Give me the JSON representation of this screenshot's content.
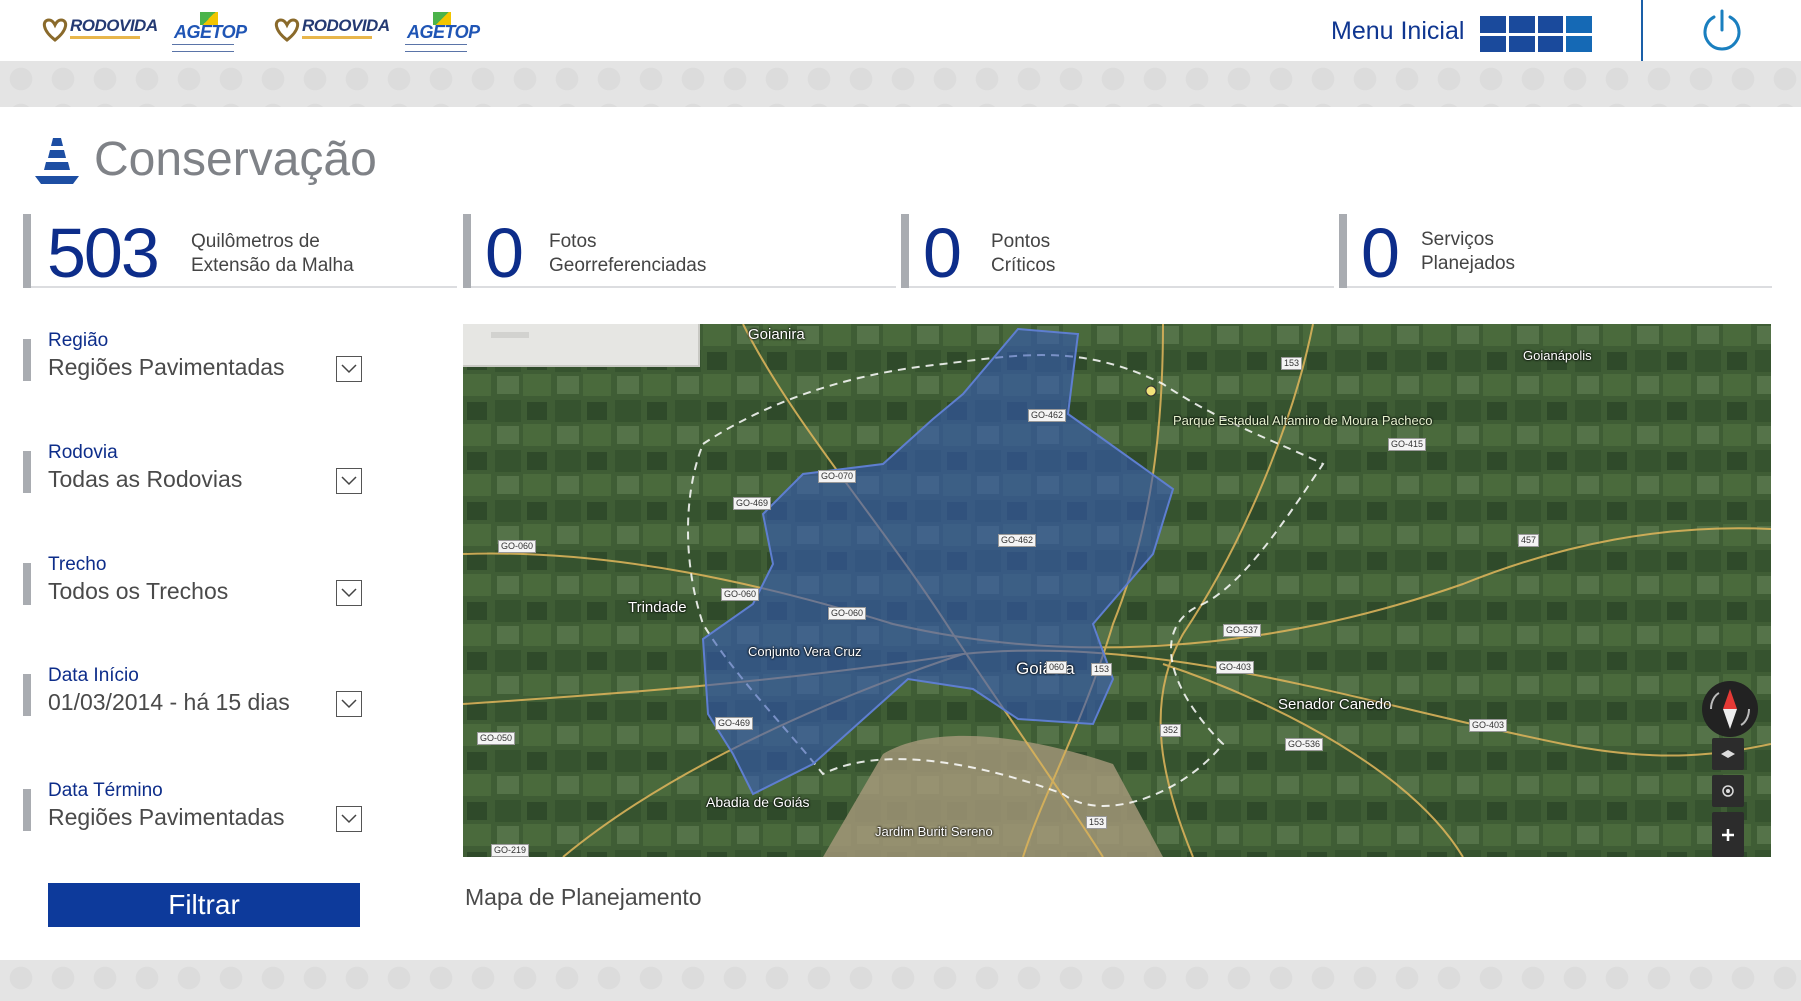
{
  "header": {
    "logos": [
      {
        "name": "RODOVIDA"
      },
      {
        "name": "AGETOP"
      },
      {
        "name": "RODOVIDA"
      },
      {
        "name": "AGETOP"
      }
    ],
    "menu_label": "Menu Inicial",
    "icons": {
      "menu": "grid-icon",
      "power": "power-icon"
    },
    "colors": {
      "brand": "#0d3a9b",
      "accent": "#1569b5"
    }
  },
  "page": {
    "title": "Conservação",
    "icon": "traffic-cone-icon"
  },
  "stats": [
    {
      "value": "503",
      "label_line1": "Quilômetros de",
      "label_line2": "Extensão da Malha"
    },
    {
      "value": "0",
      "label_line1": "Fotos",
      "label_line2": "Georreferenciadas"
    },
    {
      "value": "0",
      "label_line1": "Pontos",
      "label_line2": "Críticos"
    },
    {
      "value": "0",
      "label_line1": "Serviços",
      "label_line2": "Planejados"
    }
  ],
  "filters": {
    "regiao": {
      "label": "Região",
      "value": "Regiões Pavimentadas"
    },
    "rodovia": {
      "label": "Rodovia",
      "value": "Todas as Rodovias"
    },
    "trecho": {
      "label": "Trecho",
      "value": "Todos os Trechos"
    },
    "inicio": {
      "label": "Data Início",
      "value": "01/03/2014 - há 15 dias"
    },
    "termino": {
      "label": "Data Término",
      "value": "Regiões Pavimentadas"
    }
  },
  "filter_button": "Filtrar",
  "map": {
    "caption": "Mapa de Planejamento",
    "places": {
      "goianira": "Goianira",
      "goianapolis": "Goianápolis",
      "park": "Parque Estadual Altamiro de Moura Pacheco",
      "trindade": "Trindade",
      "vera_cruz": "Conjunto Vera Cruz",
      "goiania": "Goiânia",
      "senador": "Senador Canedo",
      "abadia": "Abadia de Goiás",
      "jardim": "Jardim Buriti Sereno"
    },
    "roads": {
      "r153a": "153",
      "go462a": "GO-462",
      "go415": "GO-415",
      "go070": "GO-070",
      "go469a": "GO-469",
      "go060a": "GO-060",
      "go462b": "GO-462",
      "r457": "457",
      "go060b": "GO-060",
      "go060c": "GO-060",
      "go537": "GO-537",
      "go403a": "GO-403",
      "go469b": "GO-469",
      "go050": "GO-050",
      "go403b": "GO-403",
      "go536": "GO-536",
      "r352": "352",
      "r153b": "153",
      "r153c": "153",
      "go219": "GO-219",
      "r060": "060"
    },
    "controls": {
      "compass": "compass-icon",
      "layers": "layers-icon",
      "locate": "locate-icon",
      "zoom_in": "zoom-in-icon"
    }
  }
}
